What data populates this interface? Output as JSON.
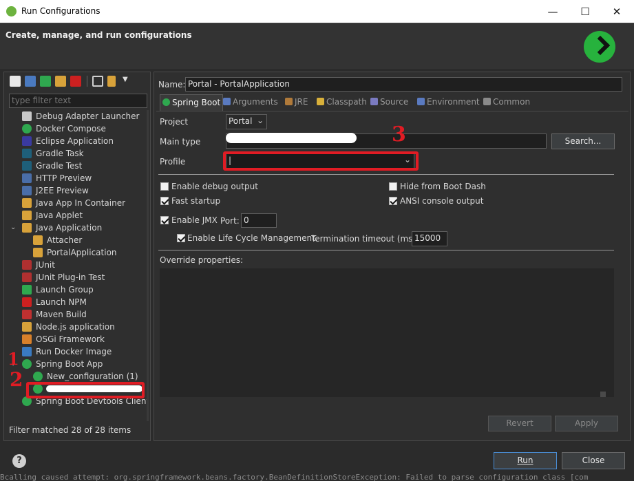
{
  "window": {
    "title": "Run Configurations",
    "minimize": "—",
    "maximize": "☐",
    "close": "✕"
  },
  "header": {
    "title": "Create, manage, and run configurations"
  },
  "left": {
    "filter_placeholder": "type filter text",
    "tree": [
      {
        "label": "Debug Adapter Launcher",
        "icon": "bug-icon",
        "color": "#c8c8c8"
      },
      {
        "label": "Docker Compose",
        "icon": "docker-compose-icon",
        "color": "#2fa84f"
      },
      {
        "label": "Eclipse Application",
        "icon": "eclipse-icon",
        "color": "#3a3aa0"
      },
      {
        "label": "Gradle Task",
        "icon": "gradle-icon",
        "color": "#1e5f7a"
      },
      {
        "label": "Gradle Test",
        "icon": "gradle-icon",
        "color": "#1e5f7a"
      },
      {
        "label": "HTTP Preview",
        "icon": "http-preview-icon",
        "color": "#4a6ea8"
      },
      {
        "label": "J2EE Preview",
        "icon": "j2ee-preview-icon",
        "color": "#4a6ea8"
      },
      {
        "label": "Java App In Container",
        "icon": "java-container-icon",
        "color": "#d8a23a"
      },
      {
        "label": "Java Applet",
        "icon": "java-applet-icon",
        "color": "#d8a23a"
      },
      {
        "label": "Java Application",
        "icon": "java-app-icon",
        "color": "#d8a23a"
      },
      {
        "label": "Attacher",
        "icon": "java-app-icon",
        "color": "#d8a23a"
      },
      {
        "label": "PortalApplication",
        "icon": "java-app-icon",
        "color": "#d8a23a"
      },
      {
        "label": "JUnit",
        "icon": "junit-icon",
        "color": "#b03030"
      },
      {
        "label": "JUnit Plug-in Test",
        "icon": "junit-icon",
        "color": "#b03030"
      },
      {
        "label": "Launch Group",
        "icon": "launch-group-icon",
        "color": "#2fa84f"
      },
      {
        "label": "Launch NPM",
        "icon": "npm-icon",
        "color": "#cc2020"
      },
      {
        "label": "Maven Build",
        "icon": "maven-icon",
        "color": "#c03030"
      },
      {
        "label": "Node.js application",
        "icon": "nodejs-icon",
        "color": "#d8a23a"
      },
      {
        "label": "OSGi Framework",
        "icon": "osgi-icon",
        "color": "#d8802a"
      },
      {
        "label": "Run Docker Image",
        "icon": "docker-icon",
        "color": "#3a7ac0"
      },
      {
        "label": "Spring Boot App",
        "icon": "spring-boot-icon",
        "color": "#2fa84f"
      },
      {
        "label": "New_configuration (1)",
        "icon": "spring-boot-icon",
        "color": "#2fa84f"
      },
      {
        "label": "",
        "icon": "spring-boot-icon",
        "color": "#2fa84f"
      },
      {
        "label": "Spring Boot Devtools Client",
        "icon": "spring-devtools-icon",
        "color": "#2fa84f"
      }
    ],
    "filter_status": "Filter matched 28 of 28 items"
  },
  "config": {
    "name_label": "Name:",
    "name_value": "Portal - PortalApplication",
    "tabs": [
      {
        "label": "Spring Boot",
        "icon": "spring-boot-icon",
        "color": "#2fa84f"
      },
      {
        "label": "Arguments",
        "icon": "arguments-icon",
        "color": "#5a7ac0"
      },
      {
        "label": "JRE",
        "icon": "jre-icon",
        "color": "#b07a3a"
      },
      {
        "label": "Classpath",
        "icon": "classpath-icon",
        "color": "#d8b03a"
      },
      {
        "label": "Source",
        "icon": "source-icon",
        "color": "#7a7ac0"
      },
      {
        "label": "Environment",
        "icon": "environment-icon",
        "color": "#5a7ac0"
      },
      {
        "label": "Common",
        "icon": "common-icon",
        "color": "#8a8a8a"
      }
    ],
    "project_label": "Project",
    "project_value": "Portal",
    "main_type_label": "Main type",
    "search_button": "Search...",
    "profile_label": "Profile",
    "profile_value": "|",
    "options": {
      "enable_debug_output": {
        "label": "Enable debug output",
        "checked": false
      },
      "hide_from_boot_dash": {
        "label": "Hide from Boot Dash",
        "checked": false
      },
      "fast_startup": {
        "label": "Fast startup",
        "checked": true
      },
      "ansi_console_output": {
        "label": "ANSI console output",
        "checked": true
      },
      "enable_jmx": {
        "label": "Enable JMX",
        "checked": true
      },
      "port_label": "Port:",
      "port_value": "0",
      "enable_lifecycle": {
        "label": "Enable Life Cycle Management.",
        "checked": true
      },
      "termination_label": "Termination timeout (ms):",
      "termination_value": "15000"
    },
    "override_label": "Override properties:",
    "revert_button": "Revert",
    "apply_button": "Apply"
  },
  "footer": {
    "run_button": "Run",
    "close_button": "Close",
    "help": "?"
  },
  "annotations": {
    "mark1": "1",
    "mark2": "2",
    "mark3": "3"
  },
  "status_line": "Bcalling caused attempt: org.springframework.beans.factory.BeanDefinitionStoreException: Failed to parse configuration class [com"
}
